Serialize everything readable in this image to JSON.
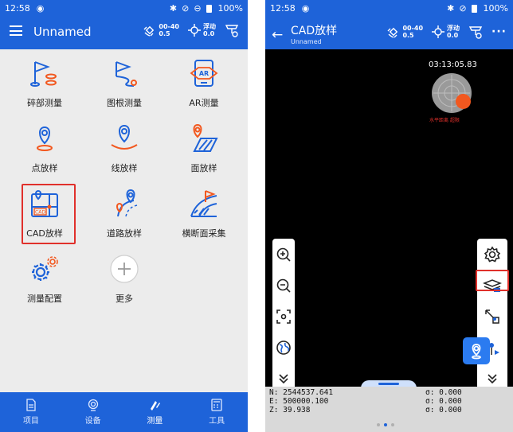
{
  "left": {
    "status_time": "12:58",
    "status_battery": "100%",
    "app_title": "Unnamed",
    "sat_top": "00-40",
    "sat_bottom": "0.5",
    "fix_top": "浮动",
    "fix_bottom": "0.0",
    "grid": [
      {
        "label": "碎部测量",
        "icon": "detail-survey-icon"
      },
      {
        "label": "图根测量",
        "icon": "control-survey-icon"
      },
      {
        "label": "AR测量",
        "icon": "ar-survey-icon"
      },
      {
        "label": "点放样",
        "icon": "point-stakeout-icon"
      },
      {
        "label": "线放样",
        "icon": "line-stakeout-icon"
      },
      {
        "label": "面放样",
        "icon": "area-stakeout-icon"
      },
      {
        "label": "CAD放样",
        "icon": "cad-stakeout-icon"
      },
      {
        "label": "道路放样",
        "icon": "road-stakeout-icon"
      },
      {
        "label": "横断面采集",
        "icon": "cross-section-icon"
      },
      {
        "label": "测量配置",
        "icon": "survey-config-icon"
      },
      {
        "label": "更多",
        "icon": "more-add-icon"
      }
    ],
    "nav": [
      {
        "label": "项目",
        "icon": "project-icon"
      },
      {
        "label": "设备",
        "icon": "device-icon"
      },
      {
        "label": "测量",
        "icon": "survey-icon"
      },
      {
        "label": "工具",
        "icon": "tools-icon"
      }
    ]
  },
  "right": {
    "status_time": "12:58",
    "status_battery": "100%",
    "title": "CAD放样",
    "subtitle": "Unnamed",
    "sat_top": "00-40",
    "sat_bottom": "0.5",
    "fix_top": "浮动",
    "fix_bottom": "0.0",
    "more": "···",
    "timer": "03:13:05.83",
    "radar_label": "水平距离 超限",
    "coords": [
      {
        "label": "N: 2544537.641",
        "sigma": "σ: 0.000"
      },
      {
        "label": "E: 500000.100",
        "sigma": "σ: 0.000"
      },
      {
        "label": "Z: 39.938",
        "sigma": "σ: 0.000"
      }
    ]
  },
  "colors": {
    "brand": "#1e63d9",
    "accent": "#f2581f",
    "highlight": "#e0302b"
  }
}
